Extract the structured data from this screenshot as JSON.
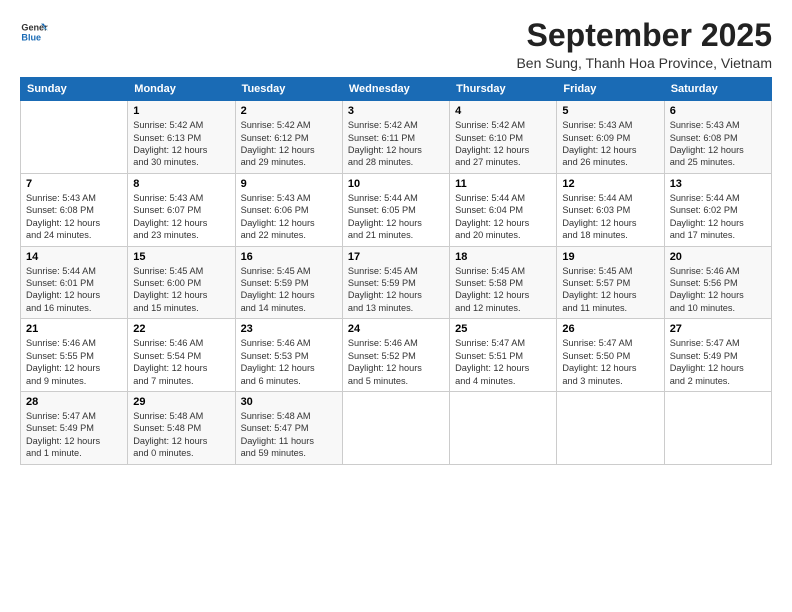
{
  "logo": {
    "line1": "General",
    "line2": "Blue"
  },
  "title": "September 2025",
  "subtitle": "Ben Sung, Thanh Hoa Province, Vietnam",
  "headers": [
    "Sunday",
    "Monday",
    "Tuesday",
    "Wednesday",
    "Thursday",
    "Friday",
    "Saturday"
  ],
  "weeks": [
    [
      {
        "num": "",
        "info": ""
      },
      {
        "num": "1",
        "info": "Sunrise: 5:42 AM\nSunset: 6:13 PM\nDaylight: 12 hours\nand 30 minutes."
      },
      {
        "num": "2",
        "info": "Sunrise: 5:42 AM\nSunset: 6:12 PM\nDaylight: 12 hours\nand 29 minutes."
      },
      {
        "num": "3",
        "info": "Sunrise: 5:42 AM\nSunset: 6:11 PM\nDaylight: 12 hours\nand 28 minutes."
      },
      {
        "num": "4",
        "info": "Sunrise: 5:42 AM\nSunset: 6:10 PM\nDaylight: 12 hours\nand 27 minutes."
      },
      {
        "num": "5",
        "info": "Sunrise: 5:43 AM\nSunset: 6:09 PM\nDaylight: 12 hours\nand 26 minutes."
      },
      {
        "num": "6",
        "info": "Sunrise: 5:43 AM\nSunset: 6:08 PM\nDaylight: 12 hours\nand 25 minutes."
      }
    ],
    [
      {
        "num": "7",
        "info": "Sunrise: 5:43 AM\nSunset: 6:08 PM\nDaylight: 12 hours\nand 24 minutes."
      },
      {
        "num": "8",
        "info": "Sunrise: 5:43 AM\nSunset: 6:07 PM\nDaylight: 12 hours\nand 23 minutes."
      },
      {
        "num": "9",
        "info": "Sunrise: 5:43 AM\nSunset: 6:06 PM\nDaylight: 12 hours\nand 22 minutes."
      },
      {
        "num": "10",
        "info": "Sunrise: 5:44 AM\nSunset: 6:05 PM\nDaylight: 12 hours\nand 21 minutes."
      },
      {
        "num": "11",
        "info": "Sunrise: 5:44 AM\nSunset: 6:04 PM\nDaylight: 12 hours\nand 20 minutes."
      },
      {
        "num": "12",
        "info": "Sunrise: 5:44 AM\nSunset: 6:03 PM\nDaylight: 12 hours\nand 18 minutes."
      },
      {
        "num": "13",
        "info": "Sunrise: 5:44 AM\nSunset: 6:02 PM\nDaylight: 12 hours\nand 17 minutes."
      }
    ],
    [
      {
        "num": "14",
        "info": "Sunrise: 5:44 AM\nSunset: 6:01 PM\nDaylight: 12 hours\nand 16 minutes."
      },
      {
        "num": "15",
        "info": "Sunrise: 5:45 AM\nSunset: 6:00 PM\nDaylight: 12 hours\nand 15 minutes."
      },
      {
        "num": "16",
        "info": "Sunrise: 5:45 AM\nSunset: 5:59 PM\nDaylight: 12 hours\nand 14 minutes."
      },
      {
        "num": "17",
        "info": "Sunrise: 5:45 AM\nSunset: 5:59 PM\nDaylight: 12 hours\nand 13 minutes."
      },
      {
        "num": "18",
        "info": "Sunrise: 5:45 AM\nSunset: 5:58 PM\nDaylight: 12 hours\nand 12 minutes."
      },
      {
        "num": "19",
        "info": "Sunrise: 5:45 AM\nSunset: 5:57 PM\nDaylight: 12 hours\nand 11 minutes."
      },
      {
        "num": "20",
        "info": "Sunrise: 5:46 AM\nSunset: 5:56 PM\nDaylight: 12 hours\nand 10 minutes."
      }
    ],
    [
      {
        "num": "21",
        "info": "Sunrise: 5:46 AM\nSunset: 5:55 PM\nDaylight: 12 hours\nand 9 minutes."
      },
      {
        "num": "22",
        "info": "Sunrise: 5:46 AM\nSunset: 5:54 PM\nDaylight: 12 hours\nand 7 minutes."
      },
      {
        "num": "23",
        "info": "Sunrise: 5:46 AM\nSunset: 5:53 PM\nDaylight: 12 hours\nand 6 minutes."
      },
      {
        "num": "24",
        "info": "Sunrise: 5:46 AM\nSunset: 5:52 PM\nDaylight: 12 hours\nand 5 minutes."
      },
      {
        "num": "25",
        "info": "Sunrise: 5:47 AM\nSunset: 5:51 PM\nDaylight: 12 hours\nand 4 minutes."
      },
      {
        "num": "26",
        "info": "Sunrise: 5:47 AM\nSunset: 5:50 PM\nDaylight: 12 hours\nand 3 minutes."
      },
      {
        "num": "27",
        "info": "Sunrise: 5:47 AM\nSunset: 5:49 PM\nDaylight: 12 hours\nand 2 minutes."
      }
    ],
    [
      {
        "num": "28",
        "info": "Sunrise: 5:47 AM\nSunset: 5:49 PM\nDaylight: 12 hours\nand 1 minute."
      },
      {
        "num": "29",
        "info": "Sunrise: 5:48 AM\nSunset: 5:48 PM\nDaylight: 12 hours\nand 0 minutes."
      },
      {
        "num": "30",
        "info": "Sunrise: 5:48 AM\nSunset: 5:47 PM\nDaylight: 11 hours\nand 59 minutes."
      },
      {
        "num": "",
        "info": ""
      },
      {
        "num": "",
        "info": ""
      },
      {
        "num": "",
        "info": ""
      },
      {
        "num": "",
        "info": ""
      }
    ]
  ]
}
